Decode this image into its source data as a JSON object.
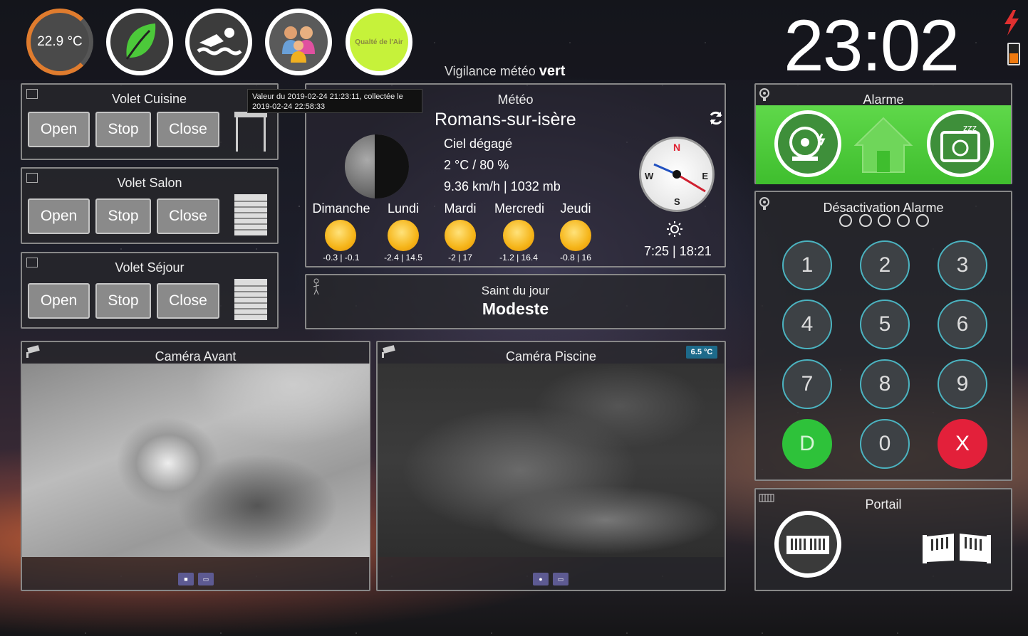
{
  "header": {
    "temperature": "22.9 °C",
    "air_quality_label": "Qualté de l'Air",
    "vigilance_prefix": "Vigilance météo",
    "vigilance_level": "vert",
    "clock": "23:02",
    "icons": [
      "leaf-icon",
      "swimmer-icon",
      "family-icon",
      "lightning-icon",
      "battery-icon"
    ],
    "colors": {
      "air_quality": "#c6f23a",
      "temp_ring": "#e07c2e",
      "battery": "#f07a10",
      "lightning": "#e03030"
    }
  },
  "shutters": [
    {
      "title": "Volet Cuisine",
      "open": "Open",
      "stop": "Stop",
      "close": "Close"
    },
    {
      "title": "Volet Salon",
      "open": "Open",
      "stop": "Stop",
      "close": "Close"
    },
    {
      "title": "Volet Séjour",
      "open": "Open",
      "stop": "Stop",
      "close": "Close"
    }
  ],
  "tooltip": "Valeur du 2019-02-24 21:23:11, collectée le 2019-02-24 22:58:33",
  "weather": {
    "title": "Météo",
    "city": "Romans-sur-isère",
    "sky": "Ciel dégagé",
    "temp_humidity": "2 °C / 80 %",
    "wind_pressure": "9.36 km/h | 1032 mb",
    "sunrise_sunset": "7:25 | 18:21",
    "compass": {
      "n": "N",
      "s": "S",
      "e": "E",
      "w": "W"
    },
    "forecast": [
      {
        "day": "Dimanche",
        "minmax": "-0.3 | -0.1"
      },
      {
        "day": "Lundi",
        "minmax": "-2.4 | 14.5"
      },
      {
        "day": "Mardi",
        "minmax": "-2 | 17"
      },
      {
        "day": "Mercredi",
        "minmax": "-1.2 | 16.4"
      },
      {
        "day": "Jeudi",
        "minmax": "-0.8 | 16"
      }
    ]
  },
  "saint": {
    "title": "Saint du jour",
    "name": "Modeste"
  },
  "cameras": [
    {
      "title": "Caméra Avant",
      "badge": ""
    },
    {
      "title": "Caméra Piscine",
      "badge": "6.5 °C"
    }
  ],
  "alarm": {
    "title": "Alarme",
    "color": "#4cc93a"
  },
  "keypad": {
    "title": "Désactivation Alarme",
    "keys": [
      "1",
      "2",
      "3",
      "4",
      "5",
      "6",
      "7",
      "8",
      "9",
      "D",
      "0",
      "X"
    ],
    "colors": {
      "d": "#2ec23a",
      "x": "#e3203a",
      "ring": "#4bb3c0"
    }
  },
  "gate": {
    "title": "Portail"
  }
}
